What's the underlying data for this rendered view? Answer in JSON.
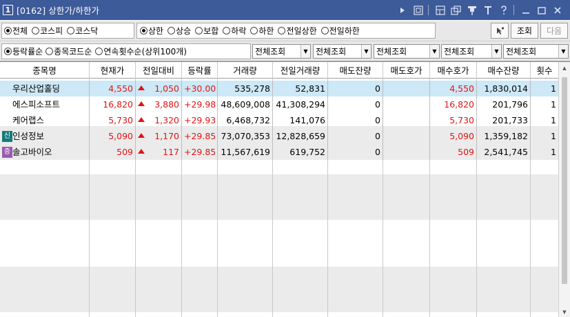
{
  "window": {
    "number": "1",
    "title": "[0162] 상한가/하한가",
    "controls": [
      "play-icon",
      "memo-icon",
      "layout-icon",
      "link-icon",
      "pin-icon",
      "font-icon",
      "help-icon",
      "minimize-icon",
      "maximize-icon",
      "close-icon"
    ]
  },
  "market_filter": [
    {
      "label": "전체",
      "selected": true
    },
    {
      "label": "코스피",
      "selected": false
    },
    {
      "label": "코스닥",
      "selected": false
    }
  ],
  "limit_filter": [
    {
      "label": "상한",
      "selected": true
    },
    {
      "label": "상승",
      "selected": false
    },
    {
      "label": "보합",
      "selected": false
    },
    {
      "label": "하락",
      "selected": false
    },
    {
      "label": "하한",
      "selected": false
    },
    {
      "label": "전일상한",
      "selected": false
    },
    {
      "label": "전일하한",
      "selected": false
    }
  ],
  "sort_filter": [
    {
      "label": "등락률순",
      "selected": true
    },
    {
      "label": "종목코드순",
      "selected": false
    },
    {
      "label": "연속횟수순(상위100개)",
      "selected": false
    }
  ],
  "buttons": {
    "search": "조회",
    "next": "다음"
  },
  "combos": [
    "전체조회",
    "전체조회",
    "전체조회",
    "전체조회",
    "전체조회"
  ],
  "columns": [
    "종목명",
    "현재가",
    "전일대비",
    "등락률",
    "거래량",
    "전일거래량",
    "매도잔량",
    "매도호가",
    "매수호가",
    "매수잔량",
    "횟수"
  ],
  "rows": [
    {
      "badge": "",
      "name": "우리산업홀딩",
      "price": "4,550",
      "change": "1,050",
      "rate": "+30.00",
      "volume": "535,278",
      "prev_volume": "52,831",
      "ask_qty": "0",
      "ask": "",
      "bid": "4,550",
      "bid_qty": "1,830,014",
      "count": "1"
    },
    {
      "badge": "",
      "name": "에스피소프트",
      "price": "16,820",
      "change": "3,880",
      "rate": "+29.98",
      "volume": "48,609,008",
      "prev_volume": "41,308,294",
      "ask_qty": "0",
      "ask": "",
      "bid": "16,820",
      "bid_qty": "201,796",
      "count": "1"
    },
    {
      "badge": "",
      "name": "케어랩스",
      "price": "5,730",
      "change": "1,320",
      "rate": "+29.93",
      "volume": "6,468,732",
      "prev_volume": "141,076",
      "ask_qty": "0",
      "ask": "",
      "bid": "5,730",
      "bid_qty": "201,733",
      "count": "1"
    },
    {
      "badge": "신",
      "name": "인성정보",
      "price": "5,090",
      "change": "1,170",
      "rate": "+29.85",
      "volume": "73,070,353",
      "prev_volume": "12,828,659",
      "ask_qty": "0",
      "ask": "",
      "bid": "5,090",
      "bid_qty": "1,359,182",
      "count": "1"
    },
    {
      "badge": "증",
      "name": "솔고바이오",
      "price": "509",
      "change": "117",
      "rate": "+29.85",
      "volume": "11,567,619",
      "prev_volume": "619,752",
      "ask_qty": "0",
      "ask": "",
      "bid": "509",
      "bid_qty": "2,541,745",
      "count": "1"
    }
  ],
  "colors": {
    "titlebar": "#3d5a99",
    "up": "#e11414",
    "selected_row": "#cde8f6",
    "badge_sin": "#147a7a",
    "badge_jeung": "#9a5ab0"
  }
}
